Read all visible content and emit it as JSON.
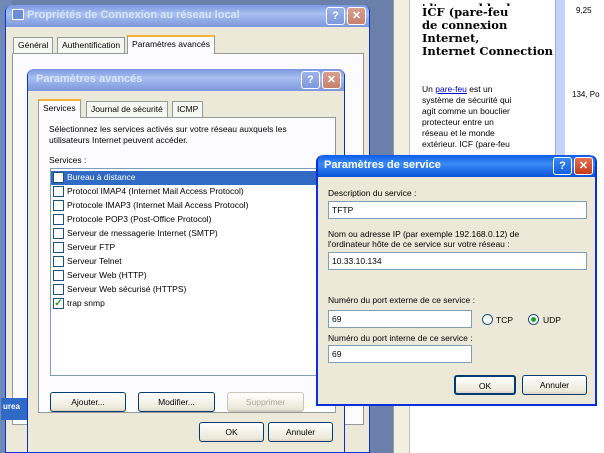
{
  "back_window": {
    "title": "Propriétés de Connexion au réseau local",
    "tabs": [
      "Général",
      "Authentification",
      "Paramètres avancés"
    ]
  },
  "help_pane": {
    "heading": "'d'ensemble de ICF (pare-feu de connexion Internet, Internet Connection",
    "heading_lines": [
      "'d'ensemble de",
      "ICF (pare-feu",
      "de connexion",
      "Internet,",
      "Internet Connection"
    ],
    "body_prefix": "Un ",
    "link": "pare-feu",
    "body_lines": [
      " est un",
      "système de sécurité qui",
      "agit comme un bouclier",
      "protecteur entre un",
      "réseau et le monde",
      "extérieur. ICF (pare-feu"
    ],
    "side_text": "134, Po",
    "top_text": "9,25"
  },
  "adv_window": {
    "title": "Paramètres avancés",
    "tabs": [
      "Services",
      "Journal de sécurité",
      "ICMP"
    ],
    "description": "Sélectionnez les services activés sur votre réseau auxquels les utilisateurs Internet peuvent accéder.",
    "services_label": "Services :",
    "services": [
      {
        "label": "Bureau à distance",
        "checked": false,
        "selected": true
      },
      {
        "label": "Protocol IMAP4 (Internet Mail Access Protocol)",
        "checked": false,
        "selected": false
      },
      {
        "label": "Protocole IMAP3 (Internet Mail Access Protocol)",
        "checked": false,
        "selected": false
      },
      {
        "label": "Protocole POP3 (Post-Office Protocol)",
        "checked": false,
        "selected": false
      },
      {
        "label": "Serveur de messagerie Internet (SMTP)",
        "checked": false,
        "selected": false
      },
      {
        "label": "Serveur FTP",
        "checked": false,
        "selected": false
      },
      {
        "label": "Serveur Telnet",
        "checked": false,
        "selected": false
      },
      {
        "label": "Serveur Web (HTTP)",
        "checked": false,
        "selected": false
      },
      {
        "label": "Serveur Web sécurisé (HTTPS)",
        "checked": false,
        "selected": false
      },
      {
        "label": "trap snmp",
        "checked": true,
        "selected": false
      }
    ],
    "add_button": "Ajouter...",
    "modify_button": "Modifier...",
    "delete_button": "Supprimer",
    "ok_button": "OK",
    "cancel_button": "Annuler"
  },
  "service_dialog": {
    "title": "Paramètres de service",
    "desc_label": "Description du service :",
    "desc_value": "TFTP",
    "host_label_1": "Nom ou adresse IP (par exemple 192.168.0.12) de",
    "host_label_2": "l'ordinateur hôte de ce service sur votre réseau :",
    "host_value": "10.33.10.134",
    "ext_port_label": "Numéro du port externe de ce service :",
    "ext_port_value": "69",
    "tcp_label": "TCP",
    "udp_label": "UDP",
    "int_port_label": "Numéro du port interne de ce service :",
    "int_port_value": "69",
    "ok_button": "OK",
    "cancel_button": "Annuler"
  },
  "colors": {
    "selection": "#316ac5",
    "xp_blue": "#0a5ce8",
    "dialog_bg": "#ece9d8"
  }
}
